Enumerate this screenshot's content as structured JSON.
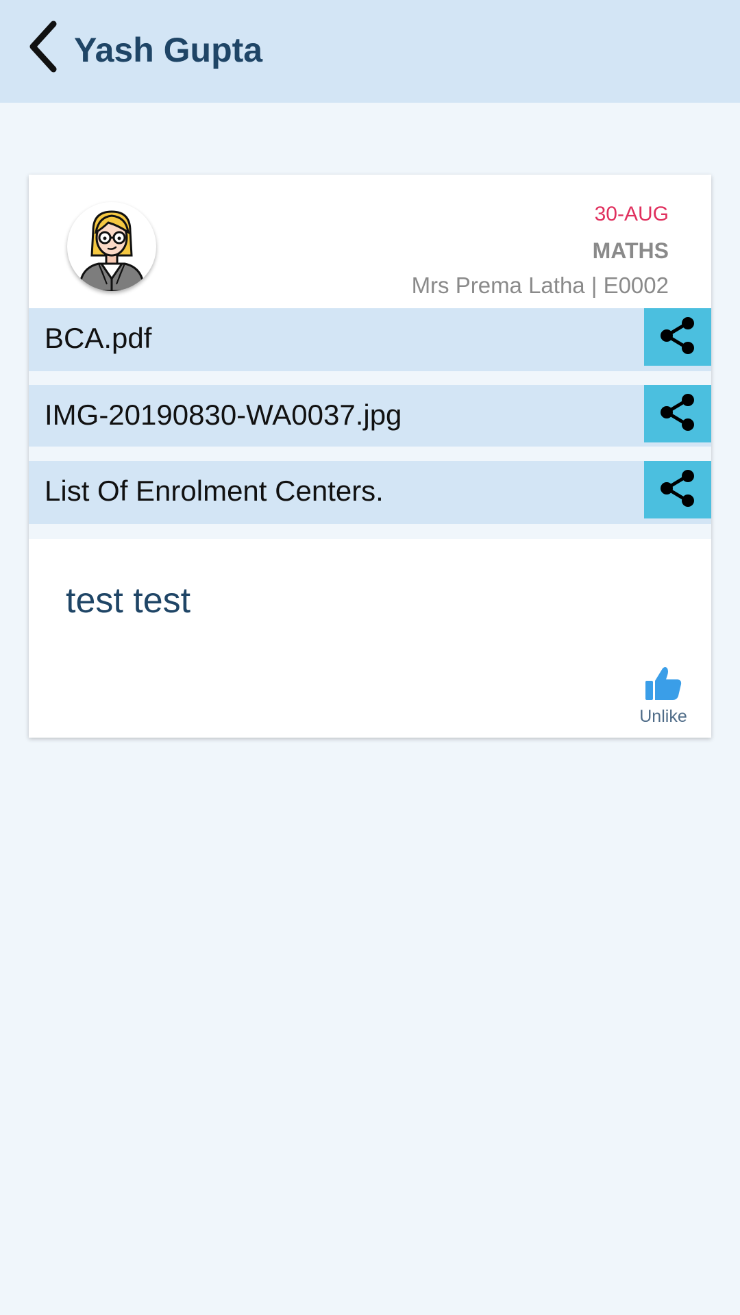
{
  "header": {
    "title": "Yash Gupta",
    "back_icon": "chevron-left-icon"
  },
  "post": {
    "avatar_icon": "teacher-avatar",
    "date": "30-AUG",
    "subject": "MATHS",
    "teacher": "Mrs Prema Latha | E0002",
    "attachments": [
      {
        "name": "BCA.pdf",
        "icon": "share-icon"
      },
      {
        "name": "IMG-20190830-WA0037.jpg",
        "icon": "share-icon"
      },
      {
        "name": "List Of Enrolment Centers.",
        "icon": "share-icon"
      }
    ],
    "message": "test test",
    "like": {
      "label": "Unlike",
      "icon": "thumbs-up-icon"
    }
  },
  "colors": {
    "header_bg": "#d3e5f5",
    "page_bg": "#f0f6fb",
    "title": "#1f4566",
    "date": "#e0305e",
    "share_bg": "#4bbfdf",
    "like": "#3a9ee8"
  }
}
